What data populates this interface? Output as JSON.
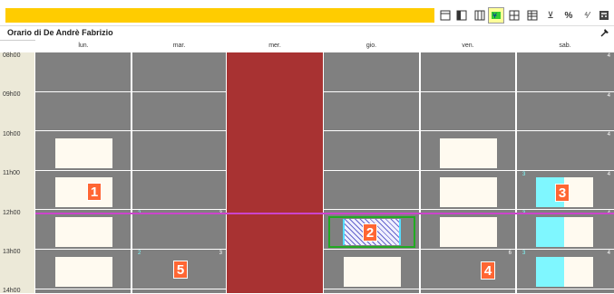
{
  "window": {
    "title": "Orario di De Andrè Fabrizio"
  },
  "toolbar": {
    "buttons": [
      {
        "name": "view-single-icon",
        "glyph": ""
      },
      {
        "name": "view-split-icon",
        "glyph": ""
      },
      {
        "name": "view-columns-icon",
        "glyph": ""
      },
      {
        "name": "view-teacher-icon",
        "glyph": ""
      },
      {
        "name": "view-grid-icon",
        "glyph": ""
      },
      {
        "name": "view-table-icon",
        "glyph": ""
      },
      {
        "name": "filter-icon",
        "glyph": "⊻"
      },
      {
        "name": "percent-icon",
        "glyph": "%"
      },
      {
        "name": "teacher-hours-icon",
        "glyph": "⁴⁄"
      },
      {
        "name": "calculator-icon",
        "glyph": ""
      }
    ]
  },
  "days": [
    "lun.",
    "mar.",
    "mer.",
    "gio.",
    "ven.",
    "sab."
  ],
  "times": [
    "08h00",
    "09h00",
    "10h00",
    "11h00",
    "12h00",
    "13h00",
    "14h00"
  ],
  "cell_numbers": {
    "sab_0": "4",
    "sab_1": "4",
    "sab_2": "4",
    "sab_3": "4",
    "sab_4": "4",
    "sab_5": "4",
    "sab_3_left": "3",
    "sab_4_left": "3",
    "sab_5_left": "3",
    "mar_4_left": "2",
    "mar_4": "3",
    "mar_5_left": "2",
    "mar_5": "3",
    "ven_5": "6"
  },
  "markers": [
    "1",
    "2",
    "3",
    "4",
    "5"
  ],
  "colors": {
    "toolbar_band": "#ffcc00",
    "cell_bg": "#808080",
    "blocked_day": "#a83232",
    "lesson": "#fffaf0",
    "highlight": "#7ff7ff",
    "now_line": "#cc44cc",
    "marker": "#ff6633",
    "selection": "#22aa22"
  }
}
